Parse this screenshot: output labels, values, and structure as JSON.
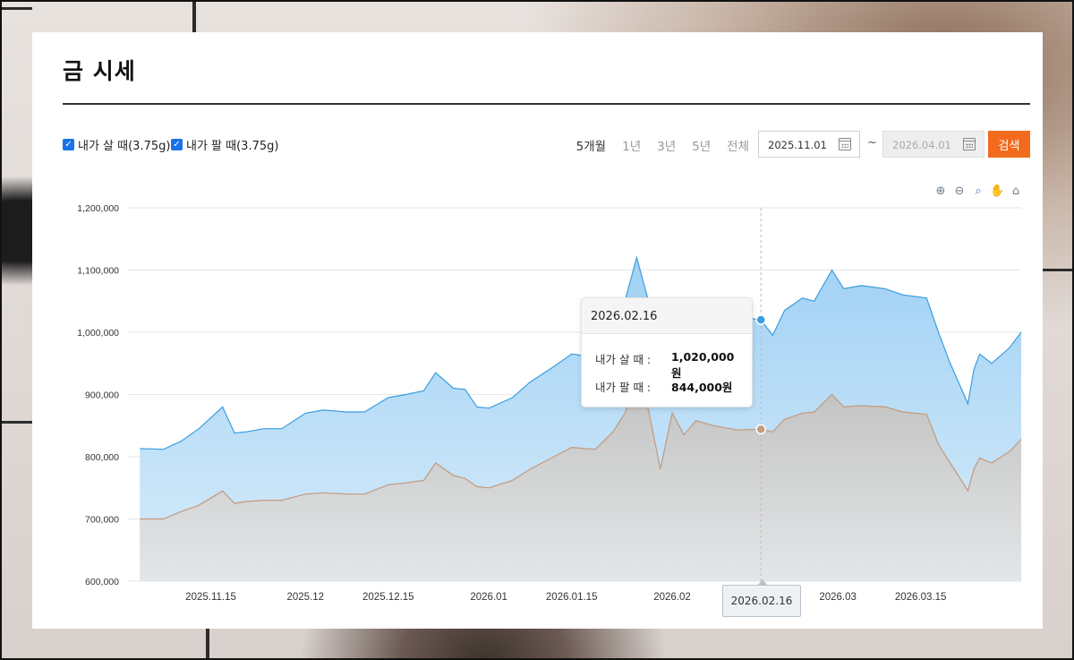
{
  "page": {
    "title": "금 시세"
  },
  "legend": [
    {
      "label": "내가 살 때(3.75g)",
      "checked": true
    },
    {
      "label": "내가 팔 때(3.75g)",
      "checked": true
    }
  ],
  "period_tabs": [
    "5개월",
    "1년",
    "3년",
    "5년",
    "전체"
  ],
  "active_period": "5개월",
  "date_range": {
    "from": "2025.11.01",
    "separator": "~",
    "to": "2026.04.01"
  },
  "search_label": "검색",
  "toolbar_icons": [
    "zoom-in-icon",
    "zoom-out-icon",
    "magnifier-zoom-icon",
    "pan-hand-icon",
    "home-icon"
  ],
  "tooltip": {
    "date": "2026.02.16",
    "rows": [
      {
        "label": "내가 살 때 :",
        "value": "1,020,000원"
      },
      {
        "label": "내가 팔 때 :",
        "value": "844,000원"
      }
    ]
  },
  "x_highlight": "2026.02.16",
  "colors": {
    "buy_line": "#3a9ee0",
    "buy_fill_top": "#9ccff4",
    "buy_fill_bottom": "#d6ebfa",
    "sell_line": "#c29a7e",
    "sell_fill_top": "#c2c0bd",
    "sell_fill_bottom": "#e4e6e8",
    "search_button": "#f26b1d"
  },
  "chart_data": {
    "type": "area",
    "title": "",
    "xlabel": "",
    "ylabel": "",
    "ylim": [
      600000,
      1200000
    ],
    "yticks": [
      "600,000",
      "700,000",
      "800,000",
      "900,000",
      "1,000,000",
      "1,100,000",
      "1,200,000"
    ],
    "xticks": [
      "2025.11.15",
      "2025.12",
      "2025.12.15",
      "2026.01",
      "2026.01.15",
      "2026.02",
      "2026.02.16",
      "2026.03",
      "2026.03.15"
    ],
    "x": [
      "2025-11-03",
      "2025-11-07",
      "2025-11-10",
      "2025-11-13",
      "2025-11-17",
      "2025-11-19",
      "2025-11-21",
      "2025-11-24",
      "2025-11-27",
      "2025-12-01",
      "2025-12-04",
      "2025-12-08",
      "2025-12-11",
      "2025-12-15",
      "2025-12-18",
      "2025-12-21",
      "2025-12-23",
      "2025-12-26",
      "2025-12-28",
      "2025-12-30",
      "2026-01-01",
      "2026-01-05",
      "2026-01-08",
      "2026-01-12",
      "2026-01-15",
      "2026-01-19",
      "2026-01-22",
      "2026-01-24",
      "2026-01-26",
      "2026-01-28",
      "2026-01-30",
      "2026-02-01",
      "2026-02-03",
      "2026-02-05",
      "2026-02-08",
      "2026-02-12",
      "2026-02-16",
      "2026-02-18",
      "2026-02-20",
      "2026-02-23",
      "2026-02-25",
      "2026-02-28",
      "2026-03-02",
      "2026-03-05",
      "2026-03-09",
      "2026-03-12",
      "2026-03-16",
      "2026-03-18",
      "2026-03-20",
      "2026-03-23",
      "2026-03-24",
      "2026-03-25",
      "2026-03-27",
      "2026-03-30",
      "2026-04-01"
    ],
    "series": [
      {
        "name": "내가 살 때(3.75g)",
        "values": [
          813000,
          812000,
          825000,
          845000,
          880000,
          838000,
          840000,
          845000,
          845000,
          870000,
          875000,
          872000,
          872000,
          895000,
          900000,
          906000,
          935000,
          910000,
          908000,
          880000,
          878000,
          895000,
          920000,
          945000,
          965000,
          960000,
          1010000,
          1050000,
          1120000,
          1050000,
          1000000,
          1020000,
          1050000,
          1010000,
          1025000,
          1025000,
          1020000,
          995000,
          1035000,
          1055000,
          1050000,
          1100000,
          1070000,
          1075000,
          1070000,
          1060000,
          1055000,
          1000000,
          950000,
          885000,
          940000,
          965000,
          950000,
          975000,
          1000000
        ]
      },
      {
        "name": "내가 팔 때(3.75g)",
        "values": [
          700000,
          700000,
          712000,
          722000,
          745000,
          725000,
          728000,
          730000,
          730000,
          740000,
          742000,
          740000,
          740000,
          755000,
          758000,
          762000,
          790000,
          770000,
          765000,
          752000,
          750000,
          762000,
          780000,
          800000,
          815000,
          812000,
          840000,
          870000,
          925000,
          875000,
          780000,
          870000,
          835000,
          858000,
          850000,
          843000,
          844000,
          840000,
          860000,
          870000,
          872000,
          900000,
          880000,
          882000,
          880000,
          872000,
          868000,
          820000,
          790000,
          745000,
          780000,
          798000,
          790000,
          808000,
          828000
        ]
      }
    ],
    "legend_position": "top-left",
    "grid": true
  }
}
